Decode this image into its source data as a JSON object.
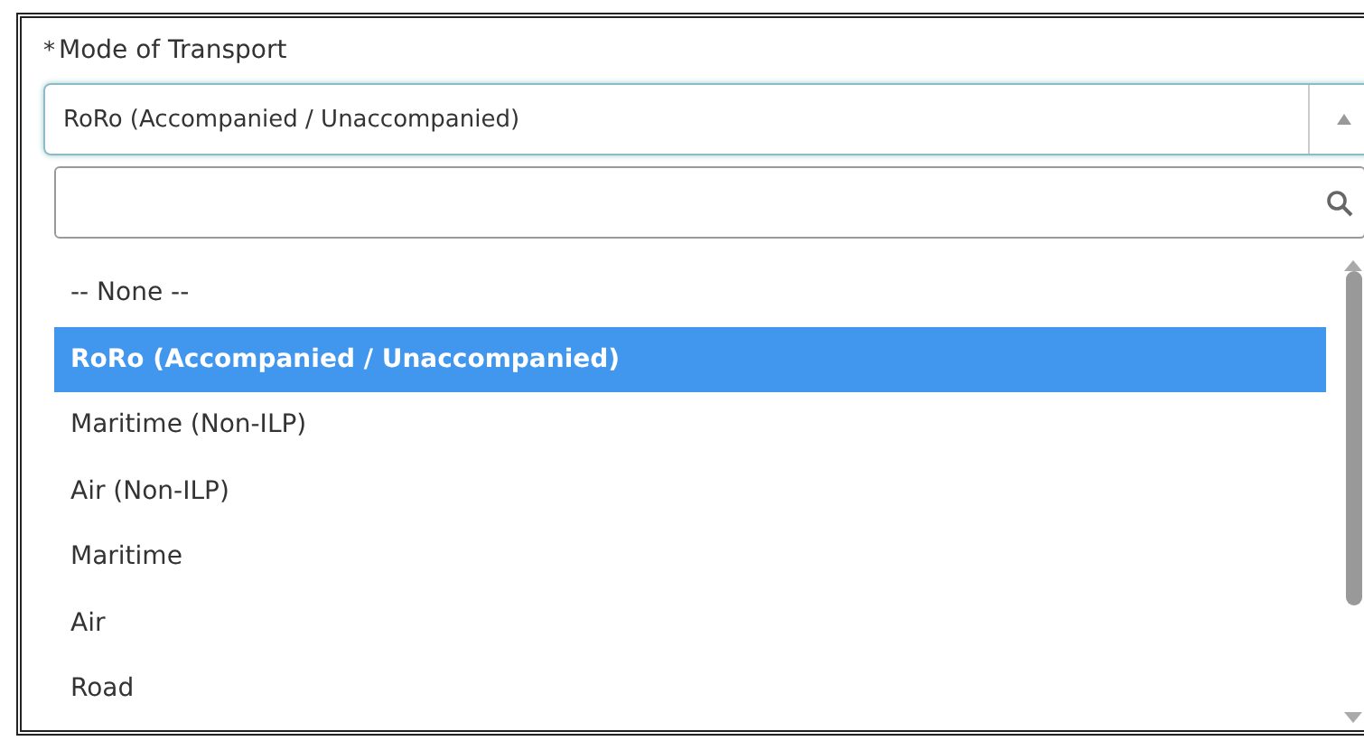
{
  "field": {
    "required_mark": "*",
    "label": "Mode of Transport",
    "value": "RoRo (Accompanied / Unaccompanied)",
    "expanded": true
  },
  "options": [
    {
      "label": "-- None --",
      "selected": false
    },
    {
      "label": "RoRo (Accompanied / Unaccompanied)",
      "selected": true
    },
    {
      "label": "Maritime (Non-ILP)",
      "selected": false
    },
    {
      "label": "Air (Non-ILP)",
      "selected": false
    },
    {
      "label": "Maritime",
      "selected": false
    },
    {
      "label": "Air",
      "selected": false
    },
    {
      "label": "Road",
      "selected": false
    }
  ]
}
